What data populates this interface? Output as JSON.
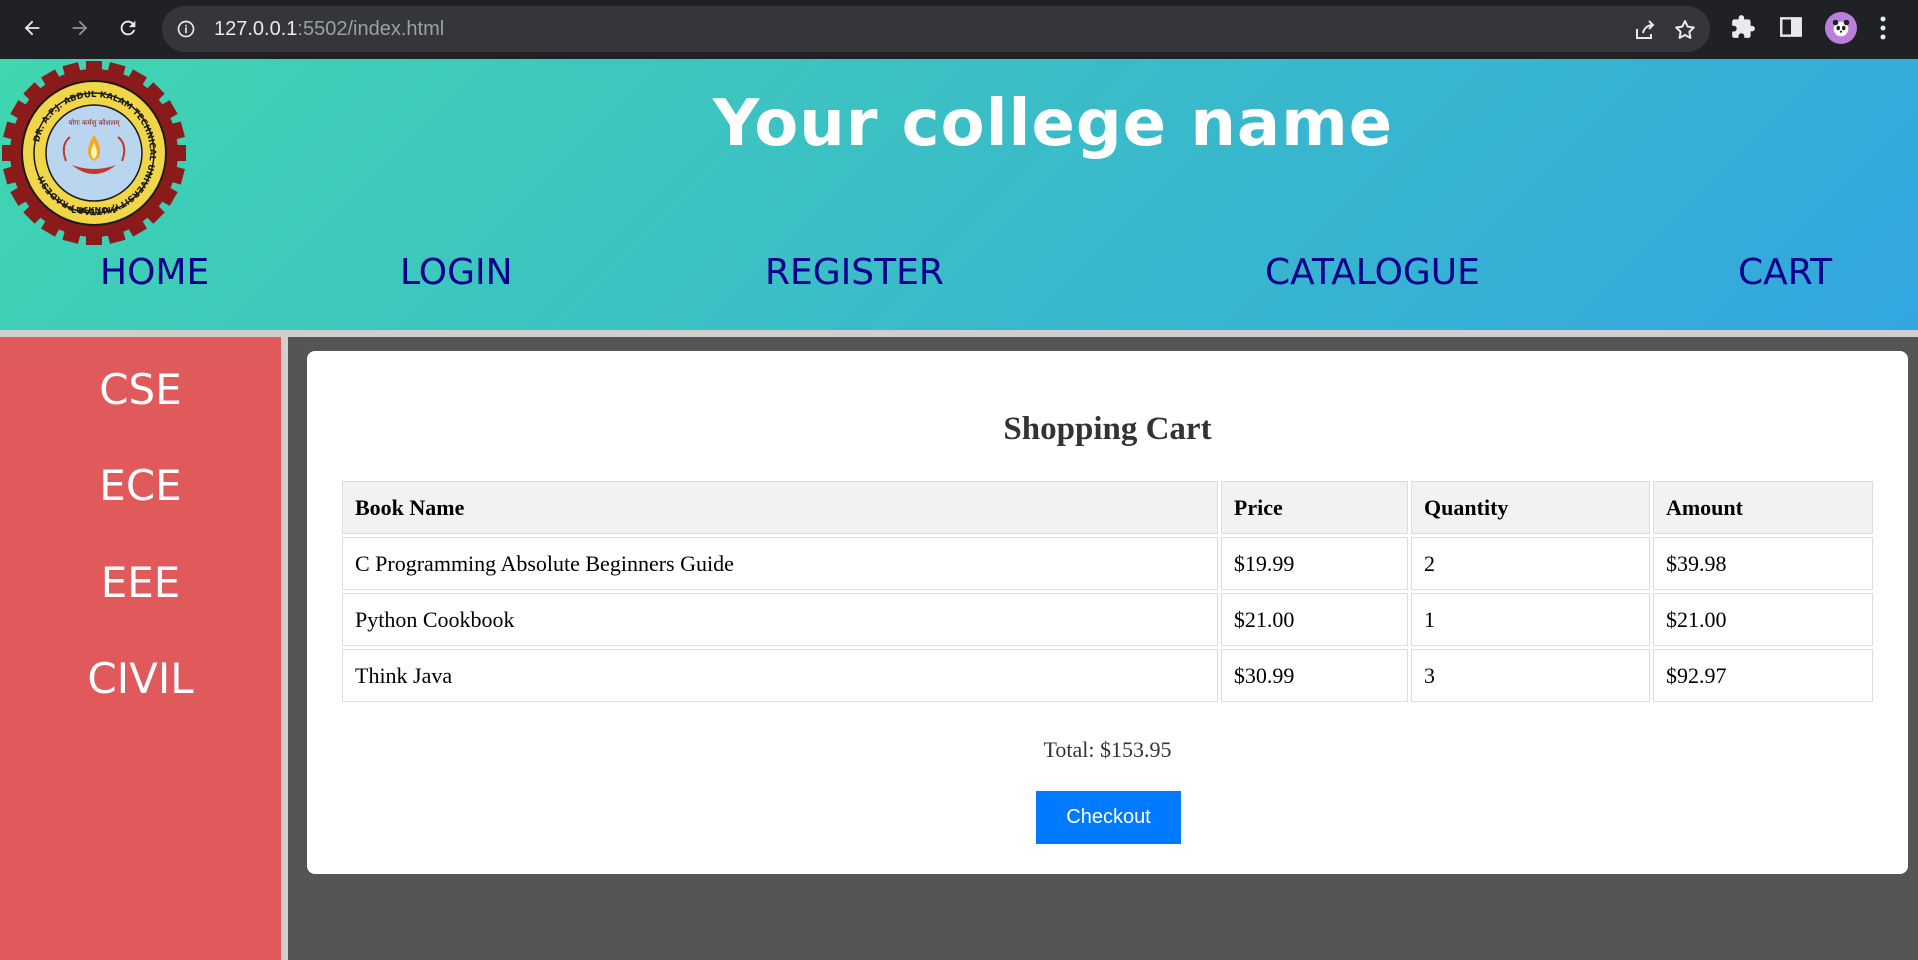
{
  "browser": {
    "url_host": "127.0.0.1",
    "url_rest": ":5502/index.html"
  },
  "header": {
    "college_name": "Your college name",
    "logo_text": {
      "top": "DR. A.P.J. ABDUL KALAM TECHNICAL UNIVERSITY, UTTAR PRADESH",
      "bottom": "LUCKNOW",
      "motto": "योगः कर्मसु कौशलम्"
    },
    "menu": [
      "HOME",
      "LOGIN",
      "REGISTER",
      "CATALOGUE",
      "CART"
    ]
  },
  "sidebar": {
    "items": [
      "CSE",
      "ECE",
      "EEE",
      "CIVIL"
    ]
  },
  "cart": {
    "title": "Shopping Cart",
    "columns": [
      "Book Name",
      "Price",
      "Quantity",
      "Amount"
    ],
    "rows": [
      [
        "C Programming Absolute Beginners Guide",
        "$19.99",
        "2",
        "$39.98"
      ],
      [
        "Python Cookbook",
        "$21.00",
        "1",
        "$21.00"
      ],
      [
        "Think Java",
        "$30.99",
        "3",
        "$92.97"
      ]
    ],
    "total": "Total: $153.95",
    "checkout_label": "Checkout"
  },
  "colors": {
    "header_gradient_start": "#40d6b0",
    "header_gradient_end": "#33a6e0",
    "menu_link": "#00008b",
    "sidebar": "#e05a5c",
    "checkout_button": "#007bff",
    "page_background": "#555555"
  }
}
